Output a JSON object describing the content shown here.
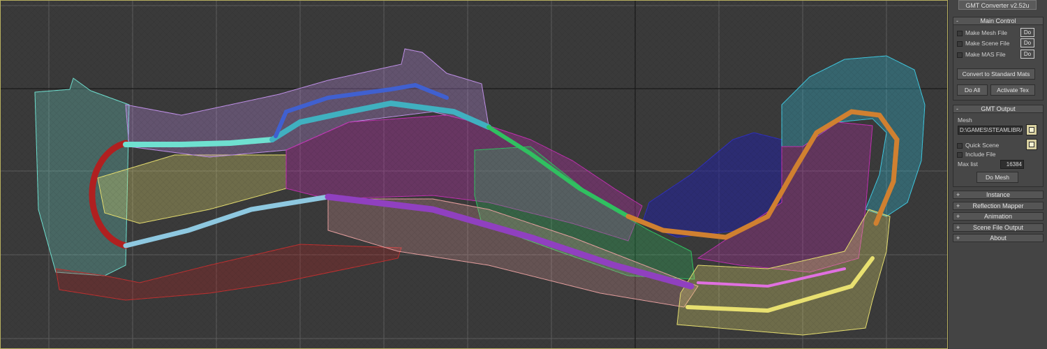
{
  "app": {
    "title_button": "GMT Converter v2.52u"
  },
  "main_control": {
    "header": "Main Control",
    "collapse_sign": "-",
    "checks": [
      {
        "label": "Make Mesh File",
        "do_label": "Do"
      },
      {
        "label": "Make Scene File",
        "do_label": "Do"
      },
      {
        "label": "Make MAS File",
        "do_label": "Do"
      }
    ],
    "convert_label": "Convert to Standard Mats",
    "do_all_label": "Do All",
    "activate_tex_label": "Activate Tex"
  },
  "gmt_output": {
    "header": "GMT Output",
    "collapse_sign": "-",
    "mesh_label": "Mesh",
    "mesh_path": "D:\\GAMES\\STEAMLIBRA",
    "quick_scene_label": "Quick Scene",
    "include_file_label": "Include File",
    "max_list_label": "Max list",
    "max_list_value": "16384",
    "do_mesh_label": "Do Mesh"
  },
  "collapsed_rollouts": [
    {
      "label": "Instance",
      "sign": "+"
    },
    {
      "label": "Reflection Mapper",
      "sign": "+"
    },
    {
      "label": "Animation",
      "sign": "+"
    },
    {
      "label": "Scene File Output",
      "sign": "+"
    },
    {
      "label": "About",
      "sign": "+"
    }
  ],
  "viewport": {
    "background": "#3a3a3a",
    "grid_color": "#5c5c5c",
    "axis_color": "#1f1f1f",
    "mesh_colors": {
      "cyan": "#6fe0d0",
      "red": "#b02020",
      "yellow": "#e8e070",
      "violet": "#c090e8",
      "magenta": "#c030b0",
      "green": "#30c060",
      "pink": "#e8a0a0",
      "blue": "#2020a0",
      "teal": "#30b8d0",
      "orange": "#d08030",
      "purple": "#9040c0"
    }
  }
}
